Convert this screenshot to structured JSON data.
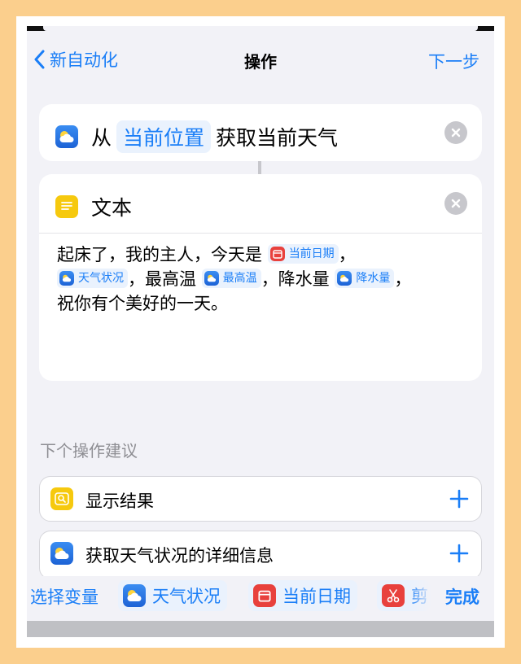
{
  "nav": {
    "back_label": "新自动化",
    "title": "操作",
    "next_label": "下一步"
  },
  "weather_action": {
    "prefix": "从",
    "location_token": "当前位置",
    "suffix": "获取当前天气"
  },
  "text_action": {
    "title": "文本",
    "line1_text": "起床了，我的主人，今天是",
    "date_chip": "当前日期",
    "comma": "，",
    "weather_chip": "天气状况",
    "high_label": "，最高温",
    "high_chip": "最高温",
    "rain_label": "，降水量",
    "rain_chip": "降水量",
    "closing": "祝你有个美好的一天。"
  },
  "suggestions": {
    "header": "下个操作建议",
    "items": [
      {
        "label": "显示结果",
        "icon": "quicklook-icon"
      },
      {
        "label": "获取天气状况的详细信息",
        "icon": "weather-icon"
      }
    ]
  },
  "variables_bar": {
    "label": "选择变量",
    "chips": [
      {
        "label": "天气状况",
        "icon": "weather-icon"
      },
      {
        "label": "当前日期",
        "icon": "calendar-icon"
      },
      {
        "label": "剪",
        "icon": "scissors-icon"
      }
    ],
    "done_label": "完成"
  },
  "colors": {
    "accent": "#1a7ef7",
    "background": "#f2f2f7",
    "frame": "#fbcf8d"
  }
}
